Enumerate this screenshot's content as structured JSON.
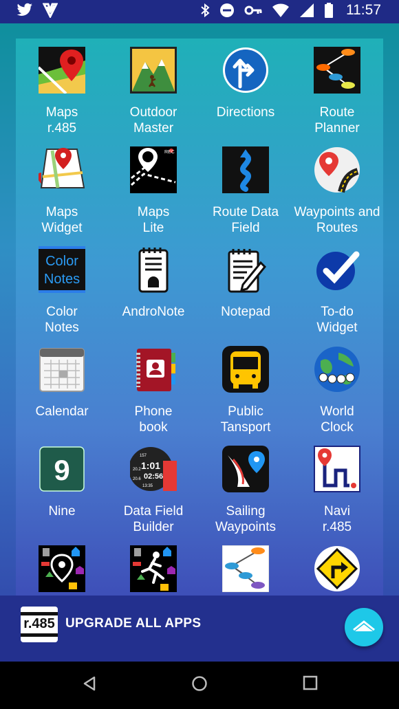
{
  "status_bar": {
    "time": "11:57",
    "left_icons": [
      "twitter-icon",
      "inbox-check-icon"
    ],
    "right_icons": [
      "bluetooth-icon",
      "do-not-disturb-icon",
      "vpn-key-icon",
      "wifi-icon",
      "cell-signal-icon",
      "battery-icon"
    ]
  },
  "apps": [
    {
      "label": "Maps\nr.485",
      "icon": "maps-pin-icon"
    },
    {
      "label": "Outdoor\nMaster",
      "icon": "mountain-hiker-icon"
    },
    {
      "label": "Directions",
      "icon": "directions-arrow-icon"
    },
    {
      "label": "Route\nPlanner",
      "icon": "route-planner-icon"
    },
    {
      "label": "Maps\nWidget",
      "icon": "maps-widget-icon"
    },
    {
      "label": "Maps\nLite",
      "icon": "maps-lite-icon"
    },
    {
      "label": "Route Data\nField",
      "icon": "route-data-field-icon"
    },
    {
      "label": "Waypoints and\nRoutes",
      "icon": "waypoints-routes-icon"
    },
    {
      "label": "Color\nNotes",
      "icon": "color-notes-icon"
    },
    {
      "label": "AndroNote",
      "icon": "andronote-icon"
    },
    {
      "label": "Notepad",
      "icon": "notepad-icon"
    },
    {
      "label": "To-do\nWidget",
      "icon": "todo-check-icon"
    },
    {
      "label": "Calendar",
      "icon": "calendar-icon"
    },
    {
      "label": "Phone\nbook",
      "icon": "phone-book-icon"
    },
    {
      "label": "Public\nTansport",
      "icon": "bus-icon"
    },
    {
      "label": "World\nClock",
      "icon": "world-clock-icon"
    },
    {
      "label": "Nine",
      "icon": "nine-icon"
    },
    {
      "label": "Data Field\nBuilder",
      "icon": "data-field-builder-icon"
    },
    {
      "label": "Sailing\nWaypoints",
      "icon": "sailing-waypoints-icon"
    },
    {
      "label": "Navi\nr.485",
      "icon": "navi-icon"
    },
    {
      "label": "",
      "icon": "places-pin-icon"
    },
    {
      "label": "",
      "icon": "places-runner-icon"
    },
    {
      "label": "",
      "icon": "route-nodes-icon"
    },
    {
      "label": "",
      "icon": "turn-sign-icon"
    }
  ],
  "upgrade": {
    "badge": "r.485",
    "label": "UPGRADE ALL APPS"
  },
  "nav": [
    "back-icon",
    "home-icon",
    "recents-icon"
  ]
}
